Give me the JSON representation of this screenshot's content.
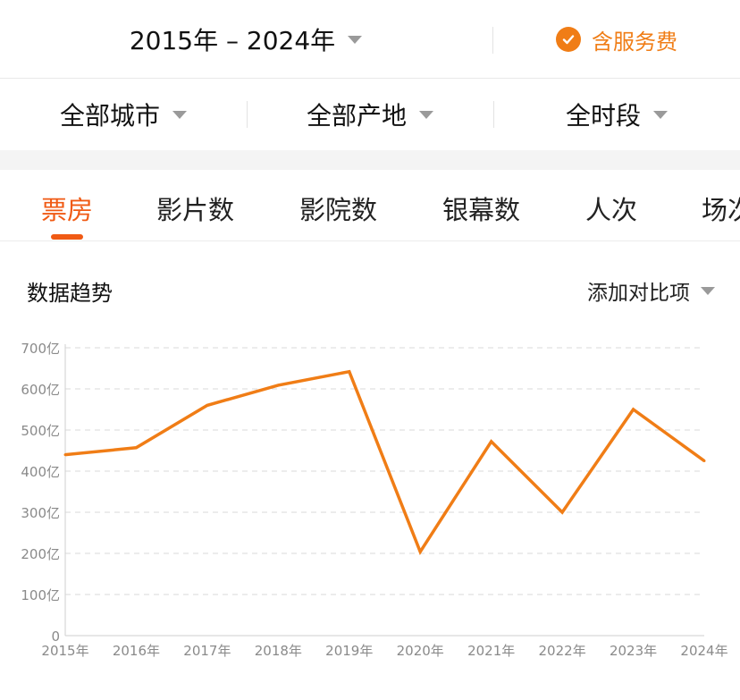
{
  "header": {
    "year_range": "2015年 – 2024年",
    "fee_label": "含服务费"
  },
  "filters": [
    {
      "label": "全部城市"
    },
    {
      "label": "全部产地"
    },
    {
      "label": "全时段"
    }
  ],
  "tabs": [
    {
      "label": "票房",
      "active": true
    },
    {
      "label": "影片数"
    },
    {
      "label": "影院数"
    },
    {
      "label": "银幕数"
    },
    {
      "label": "人次"
    },
    {
      "label": "场次"
    }
  ],
  "section": {
    "title": "数据趋势",
    "compare_label": "添加对比项"
  },
  "colors": {
    "accent": "#f05a14",
    "line": "#f07d16"
  },
  "chart_data": {
    "type": "line",
    "x": [
      "2015年",
      "2016年",
      "2017年",
      "2018年",
      "2019年",
      "2020年",
      "2021年",
      "2022年",
      "2023年",
      "2024年"
    ],
    "series": [
      {
        "values": [
          440,
          457,
          560,
          609,
          642,
          204,
          472,
          300,
          550,
          425
        ]
      }
    ],
    "y_ticks": [
      "0",
      "100亿",
      "200亿",
      "300亿",
      "400亿",
      "500亿",
      "600亿",
      "700亿"
    ],
    "ylim": [
      0,
      700
    ],
    "grid": true
  }
}
